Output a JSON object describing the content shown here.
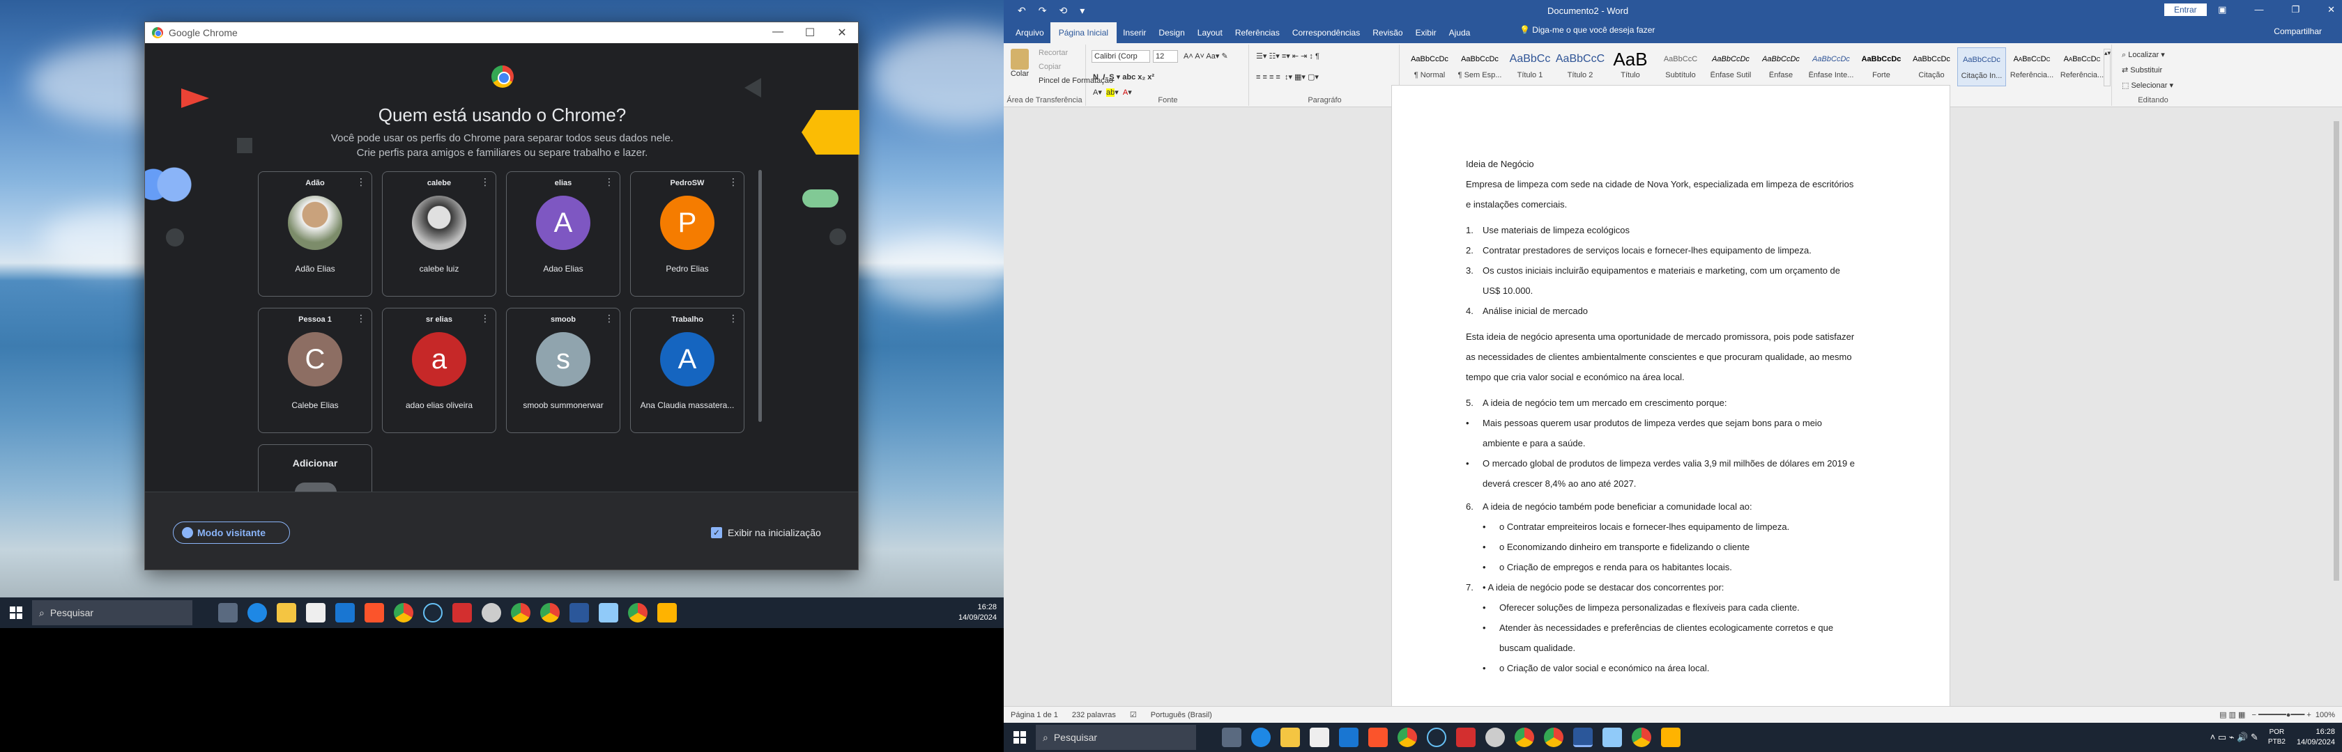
{
  "chrome": {
    "window_title": "Google Chrome",
    "controls": [
      "—",
      "☐",
      "✕"
    ],
    "heading": "Quem está usando o Chrome?",
    "subtitle_line1": "Você pode usar os perfis do Chrome para separar todos seus dados nele.",
    "subtitle_line2": "Crie perfis para amigos e familiares ou separe trabalho e lazer.",
    "profiles": [
      {
        "name": "Adão",
        "label": "Adão Elias",
        "initial": "",
        "color": "#6d7a6a"
      },
      {
        "name": "calebe",
        "label": "calebe luiz",
        "initial": "",
        "color": "#9aa0a6"
      },
      {
        "name": "elias",
        "label": "Adao Elias",
        "initial": "A",
        "color": "#7e57c2"
      },
      {
        "name": "PedroSW",
        "label": "Pedro Elias",
        "initial": "P",
        "color": "#f57c00"
      },
      {
        "name": "Pessoa 1",
        "label": "Calebe Elias",
        "initial": "C",
        "color": "#8d6e63"
      },
      {
        "name": "sr elias",
        "label": "adao elias oliveira",
        "initial": "a",
        "color": "#c62828"
      },
      {
        "name": "smoob",
        "label": "smoob summonerwar",
        "initial": "s",
        "color": "#90a4ae"
      },
      {
        "name": "Trabalho",
        "label": "Ana Claudia massatera...",
        "initial": "A",
        "color": "#1565c0"
      }
    ],
    "add_label": "Adicionar",
    "guest_label": "Modo visitante",
    "startup_label": "Exibir na inicialização"
  },
  "taskbar": {
    "search": "Pesquisar",
    "time": "16:28",
    "date": "14/09/2024",
    "lang1": "POR",
    "lang2": "PTB2"
  },
  "word": {
    "doc_title": "Documento2 - Word",
    "signin": "Entrar",
    "share": "Compartilhar",
    "tabs": [
      "Arquivo",
      "Página Inicial",
      "Inserir",
      "Design",
      "Layout",
      "Referências",
      "Correspondências",
      "Revisão",
      "Exibir",
      "Ajuda"
    ],
    "tellme": "Diga-me o que você deseja fazer",
    "clipboard": {
      "paste": "Colar",
      "cut": "Recortar",
      "copy": "Copiar",
      "format": "Pincel de Formatação",
      "label": "Área de Transferência"
    },
    "font": {
      "name": "Calibri (Corp",
      "size": "12",
      "label": "Fonte"
    },
    "paragraph_label": "Paragráfo",
    "styles_label": "Estilos",
    "editing": {
      "find": "Localizar",
      "replace": "Substituir",
      "select": "Selecionar",
      "label": "Editando"
    },
    "styles": [
      {
        "preview": "AaBbCcDc",
        "name": "¶ Normal"
      },
      {
        "preview": "AaBbCcDc",
        "name": "¶ Sem Esp..."
      },
      {
        "preview": "AaBbCc",
        "name": "Título 1"
      },
      {
        "preview": "AaBbCcC",
        "name": "Título 2"
      },
      {
        "preview": "AaB",
        "name": "Título"
      },
      {
        "preview": "AaBbCcC",
        "name": "Subtítulo"
      },
      {
        "preview": "AaBbCcDc",
        "name": "Ênfase Sutil"
      },
      {
        "preview": "AaBbCcDc",
        "name": "Ênfase"
      },
      {
        "preview": "AaBbCcDc",
        "name": "Ênfase Inte..."
      },
      {
        "preview": "AaBbCcDc",
        "name": "Forte"
      },
      {
        "preview": "AaBbCcDc",
        "name": "Citação"
      },
      {
        "preview": "AaBbCcDc",
        "name": "Citação In..."
      },
      {
        "preview": "AaBbCcDc",
        "name": "Referência..."
      },
      {
        "preview": "AaBbCcDc",
        "name": "Referência..."
      }
    ],
    "doc": {
      "title": "Ideia de Negócio",
      "intro": "Empresa de limpeza com sede na cidade de Nova York, especializada em limpeza de escritórios e instalações comerciais.",
      "list1": [
        {
          "n": "1.",
          "t": "Use materiais de limpeza ecológicos"
        },
        {
          "n": "2.",
          "t": "Contratar prestadores de serviços locais e fornecer-lhes equipamento de limpeza."
        },
        {
          "n": "3.",
          "t": "Os custos iniciais incluirão equipamentos e materiais e marketing, com um orçamento de US$ 10.000."
        },
        {
          "n": "4.",
          "t": "Análise inicial de mercado"
        }
      ],
      "para": "Esta ideia de negócio apresenta uma oportunidade de mercado promissora, pois pode satisfazer as necessidades de clientes ambientalmente conscientes e que procuram qualidade, ao mesmo tempo que cria valor social e económico na área local.",
      "item5": {
        "n": "5.",
        "t": "A ideia de negócio tem um mercado em crescimento porque:"
      },
      "bullets5": [
        {
          "n": "•",
          "t": "Mais pessoas querem usar produtos de limpeza verdes que sejam bons para o meio ambiente e para a saúde."
        },
        {
          "n": "•",
          "t": "O mercado global de produtos de limpeza verdes valia 3,9 mil milhões de dólares em 2019 e deverá crescer 8,4% ao ano até 2027."
        }
      ],
      "item6": {
        "n": "6.",
        "t": "A ideia de negócio também pode beneficiar a comunidade local ao:"
      },
      "bullets6": [
        {
          "n": "•",
          "t": "o Contratar empreiteiros locais e fornecer-lhes equipamento de limpeza."
        },
        {
          "n": "•",
          "t": "o Economizando dinheiro em transporte e fidelizando o cliente"
        },
        {
          "n": "•",
          "t": "o Criação de empregos e renda para os habitantes locais."
        }
      ],
      "item7": {
        "n": "7.",
        "t": "• A ideia de negócio pode se destacar dos concorrentes por:"
      },
      "bullets7": [
        {
          "n": "•",
          "t": "Oferecer soluções de limpeza personalizadas e flexíveis para cada cliente."
        },
        {
          "n": "•",
          "t": "Atender às necessidades e preferências de clientes ecologicamente corretos e que buscam qualidade."
        },
        {
          "n": "•",
          "t": "o Criação de valor social e económico na área local."
        }
      ]
    },
    "status": {
      "page": "Página 1 de 1",
      "words": "232 palavras",
      "lang": "Português (Brasil)",
      "zoom": "100%"
    }
  }
}
